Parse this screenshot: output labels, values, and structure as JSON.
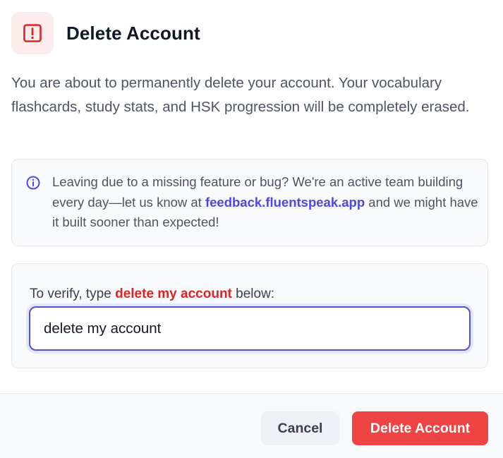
{
  "dialog": {
    "title": "Delete Account",
    "description": "You are about to permanently delete your account. Your vocabulary flashcards, study stats, and HSK progression will be completely erased."
  },
  "info": {
    "text_before": "Leaving due to a missing feature or bug? We're an active team building every day—let us know at ",
    "link_text": "feedback.fluentspeak.app",
    "text_after": " and we might have it built sooner than expected!"
  },
  "verify": {
    "label_before": "To verify, type ",
    "phrase": "delete my account",
    "label_after": " below:",
    "input_value": "delete my account"
  },
  "footer": {
    "cancel_label": "Cancel",
    "delete_label": "Delete Account"
  },
  "icons": {
    "warning": "alert-square-icon",
    "info": "info-circle-icon"
  },
  "colors": {
    "danger": "#ef4444",
    "danger_text": "#dc2626",
    "link": "#4f46e5",
    "focus_border": "#5b4fd0"
  }
}
